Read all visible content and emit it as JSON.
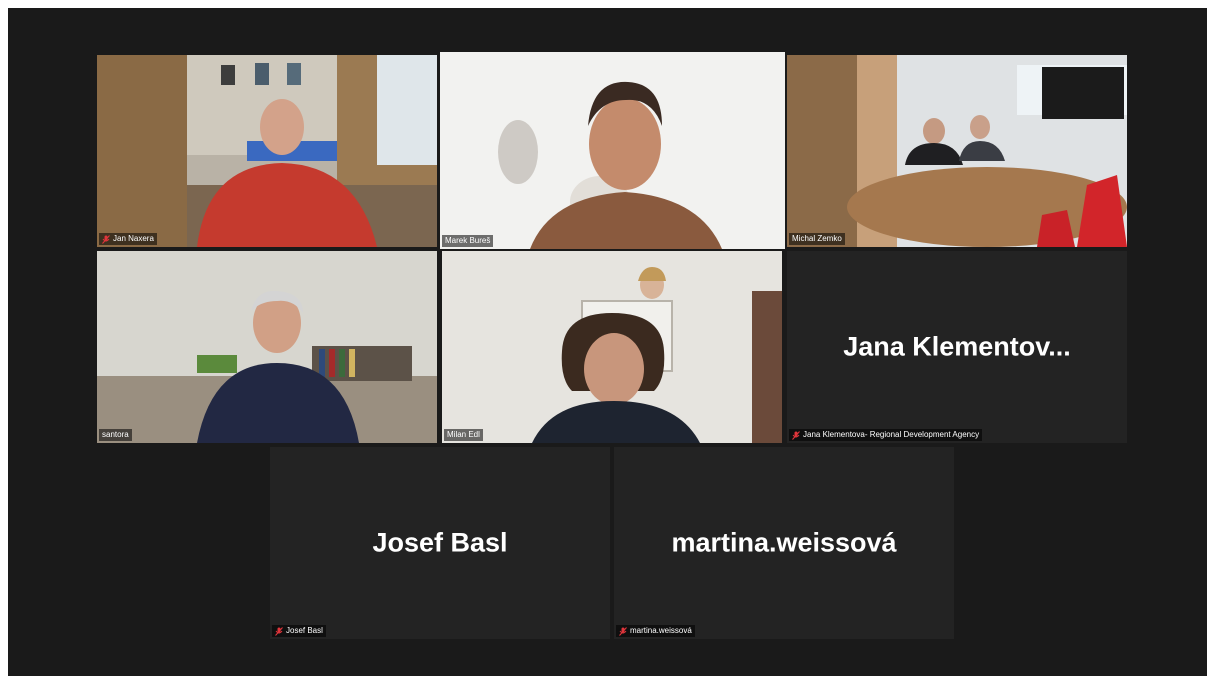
{
  "participants": {
    "jan_naxera": {
      "label": "Jan Naxera"
    },
    "marek_bures": {
      "label": "Marek Bureš"
    },
    "michal_zemko": {
      "label": "Michal Zemko"
    },
    "santora": {
      "label": "santora"
    },
    "milan_edl": {
      "label": "Milan Edl"
    },
    "jana_klementova": {
      "label": "Jana Klementova- Regional Development Agency",
      "display_name": "Jana  Klementov..."
    },
    "josef_basl": {
      "label": "Josef Basl",
      "display_name": "Josef Basl"
    },
    "martina_weissova": {
      "label": "martina.weissová",
      "display_name": "martina.weissová"
    }
  },
  "colors": {
    "active_speaker": "#d6ec57",
    "mute": "#e0353b",
    "tile_bg": "#232323",
    "window_bg": "#1a1a1a"
  }
}
